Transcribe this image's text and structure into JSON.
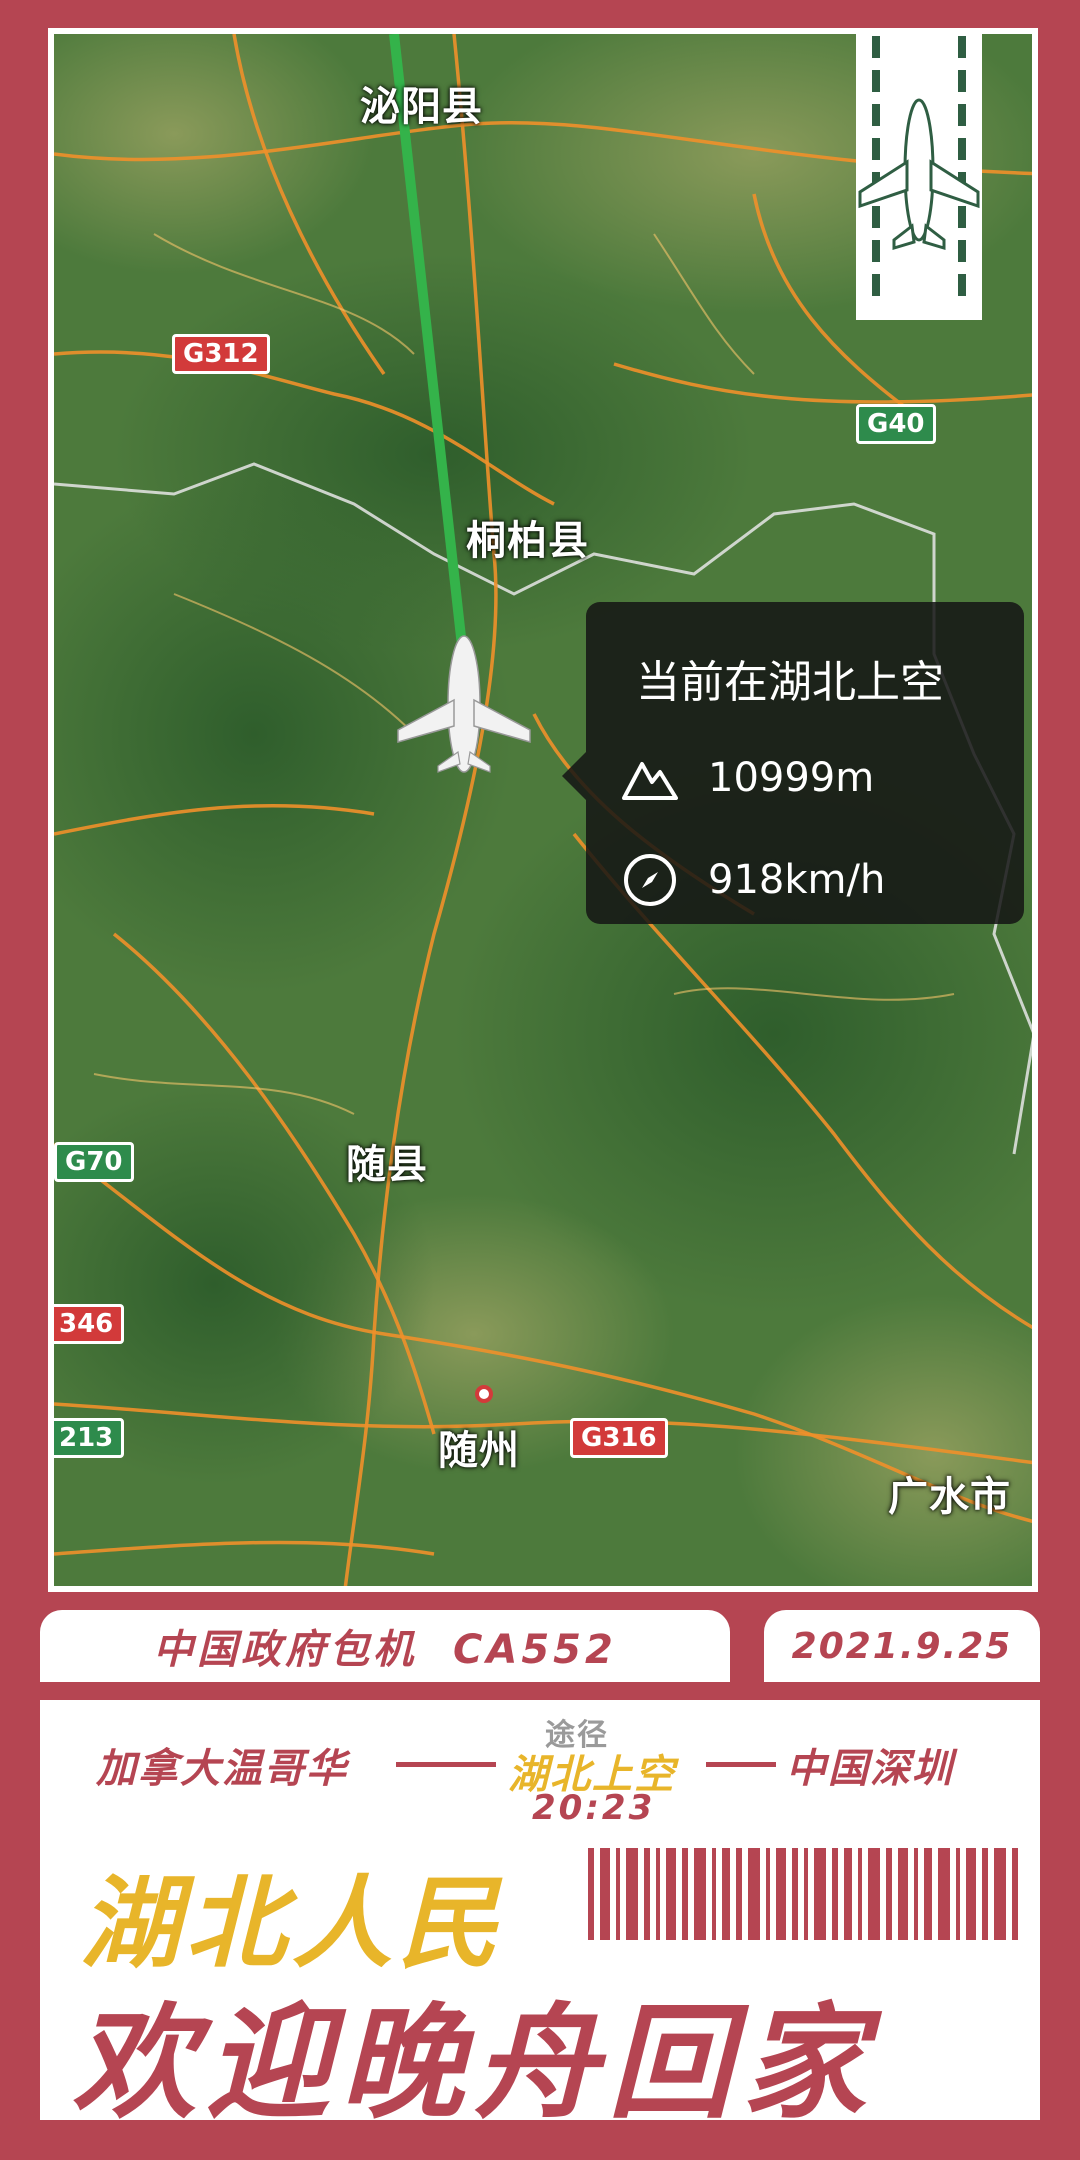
{
  "map": {
    "places": [
      "泌阳县",
      "桐柏县",
      "随县",
      "随州",
      "广水市"
    ],
    "shields": {
      "g312": "G312",
      "g40": "G40",
      "g70": "G70",
      "s346": "346",
      "s213": "213",
      "g316": "G316"
    },
    "popup": {
      "title": "当前在湖北上空",
      "altitude": "10999m",
      "speed": "918km/h"
    },
    "route_color": "#34b34a"
  },
  "ticket": {
    "flight_label": "中国政府包机  CA552",
    "date": "2021.9.25",
    "origin": "加拿大温哥华",
    "destination": "中国深圳",
    "via_label": "途径",
    "via_place": "湖北上空",
    "via_time": "20:23",
    "slogan_line1": "湖北人民",
    "slogan_line2": "欢迎晚舟回家"
  },
  "colors": {
    "brand_red": "#b54552",
    "accent_yellow": "#e8b52a"
  }
}
